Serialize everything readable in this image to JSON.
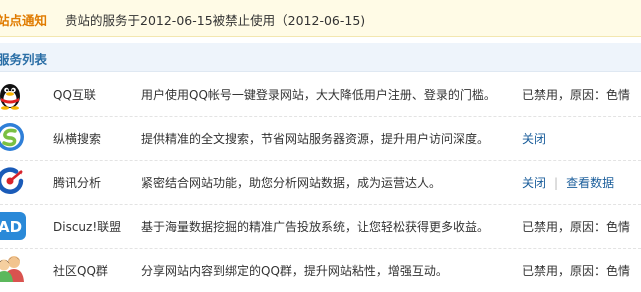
{
  "notice": {
    "label": "站点通知",
    "text": "贵站的服务于2012-06-15被禁止使用（2012-06-15)"
  },
  "service_list": {
    "title": "服务列表",
    "items": [
      {
        "name": "QQ互联",
        "description": "用户使用QQ帐号一键登录网站，大大降低用户注册、登录的门槛。",
        "status": "已禁用，原因：色情"
      },
      {
        "name": "纵横搜索",
        "description": "提供精准的全文搜索，节省网站服务器资源，提升用户访问深度。",
        "action": "关闭"
      },
      {
        "name": "腾讯分析",
        "description": "紧密结合网站功能，助您分析网站数据，成为运营达人。",
        "action": "关闭",
        "extra_action": "查看数据"
      },
      {
        "name": "Discuz!联盟",
        "description": "基于海量数据挖掘的精准广告投放系统，让您轻松获得更多收益。",
        "status": "已禁用，原因：色情"
      },
      {
        "name": "社区QQ群",
        "description": "分享网站内容到绑定的QQ群，提升网站粘性，增强互动。",
        "status": "已禁用，原因：色情"
      }
    ]
  }
}
